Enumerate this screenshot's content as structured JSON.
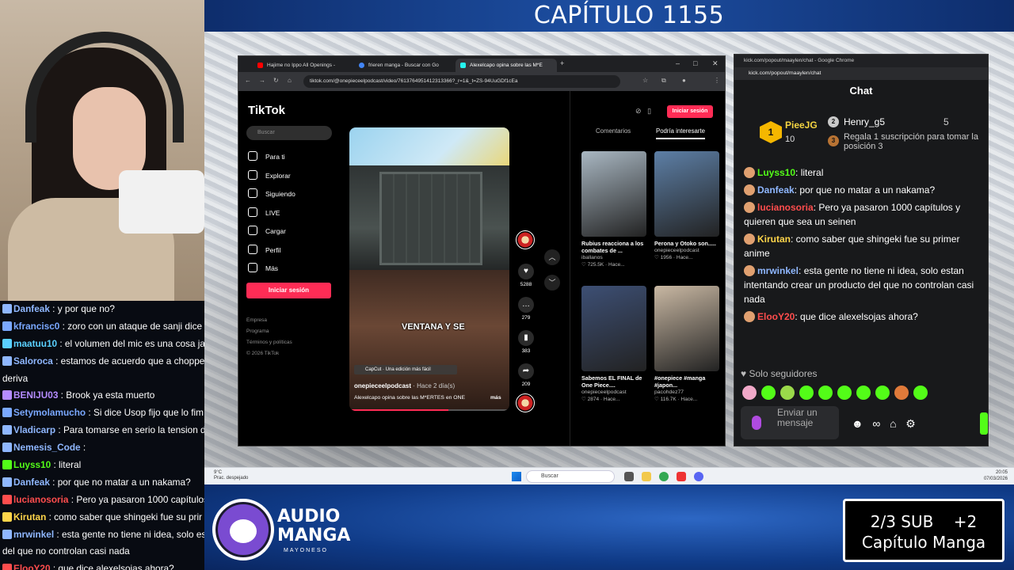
{
  "stream": {
    "chapter_title": "CAPÍTULO 1155",
    "logo_line1": "AUDIO",
    "logo_line2": "MANGA",
    "logo_line3": "MAYONESO",
    "subgoal_line1": "2/3 SUB    +2",
    "subgoal_line2": "Capítulo Manga"
  },
  "stream_chat": [
    {
      "name": "Danfeak",
      "text": " : y por que no?",
      "color": "#8fb7ff"
    },
    {
      "name": "kfrancisc0",
      "text": " : zoro con un ataque de sanji dice",
      "color": "#7aa8ff"
    },
    {
      "name": "maatuu10",
      "text": " : el volumen del mic es una cosa jaja",
      "color": "#5ad0ff"
    },
    {
      "name": "Saloroca",
      "text": " : estamos de acuerdo que a chopper s",
      "color": "#8fb7ff"
    },
    {
      "name": "",
      "text": "deriva",
      "color": "#ffffff"
    },
    {
      "name": "BENIJU03",
      "text": " : Brook ya esta muerto",
      "color": "#b58cff"
    },
    {
      "name": "Setymolamucho",
      "text": " : Si dice Usop fijo que lo fim",
      "color": "#7aa8ff"
    },
    {
      "name": "Vladicarp",
      "text": " : Para tomarse en serio la tension d",
      "color": "#8fb7ff"
    },
    {
      "name": "Nemesis_Code",
      "text": " :",
      "color": "#8fb7ff"
    },
    {
      "name": "Luyss10",
      "text": " : literal",
      "color": "#53fc18"
    },
    {
      "name": "Danfeak",
      "text": " : por que no matar a un nakama?",
      "color": "#8fb7ff"
    },
    {
      "name": "lucianosoria",
      "text": " : Pero ya pasaron 1000 capítulos y",
      "color": "#ff4d4d"
    },
    {
      "name": "Kirutan",
      "text": " : como saber que shingeki fue su prir",
      "color": "#ffd54a"
    },
    {
      "name": "mrwinkel",
      "text": " : esta gente no tiene ni idea, solo esta",
      "color": "#8fb7ff"
    },
    {
      "name": "",
      "text": "del que no controlan casi nada",
      "color": "#ffffff"
    },
    {
      "name": "ElooY20",
      "text": " : que dice alexelsojas ahora?",
      "color": "#ff4d4d"
    }
  ],
  "taskbar": {
    "weather_temp": "9°C",
    "weather_desc": "Prac. despejado",
    "search_placeholder": "Buscar",
    "time": "20:05",
    "date": "07/03/2026"
  },
  "browser": {
    "tabs": [
      {
        "label": "Hajime no Ippo All Openings -",
        "fav": "#ff0000"
      },
      {
        "label": "frieren manga - Buscar con Go",
        "fav": "#4285f4"
      },
      {
        "label": "Alexelcapo opina sobre las M*E",
        "fav": "#25f4ee"
      }
    ],
    "url": "tiktok.com/@onepieceelpodcast/video/7613764951412313366?_r=1&_t=ZS-94UuGDf1cEa"
  },
  "tiktok": {
    "logo": "TikTok",
    "search_placeholder": "Buscar",
    "nav": [
      "Para ti",
      "Explorar",
      "Siguiendo",
      "LIVE",
      "Cargar",
      "Perfil",
      "Más"
    ],
    "login_button": "Iniciar sesión",
    "footer": [
      "Empresa",
      "Programa",
      "Términos y políticas",
      "© 2026 TikTok"
    ],
    "video": {
      "caption": "VENTANA Y SE",
      "capcut": "CapCut · Una edición más fácil",
      "author": "onepieceelpodcast",
      "ago": " · Hace 2 día(s)",
      "description": "Alexelcapo opina sobre las M*ERTES en ONE",
      "more": "más",
      "progress": 0.62
    },
    "actions": {
      "likes": "5288",
      "comments": "279",
      "saves": "383",
      "shares": "209"
    },
    "right_tabs": [
      "Comentarios",
      "Podría interesarte"
    ],
    "cards": [
      {
        "title": "Rubius reacciona a los combates de ...",
        "user": "iballanos",
        "stats": "♡ 725.5K · Hace...",
        "color": "#a9b7c2"
      },
      {
        "title": "Perona y Otoko son.....",
        "user": "onepieceelpodcast",
        "stats": "♡ 1956 · Hace...",
        "color": "#5d7fa6"
      },
      {
        "title": "Sabemos EL FINAL de One Piece....",
        "user": "onepieceelpodcast",
        "stats": "♡ 2874 · Hace...",
        "color": "#3d4f74"
      },
      {
        "title": "#onepiece #manga #japon...",
        "user": "pacohdez77",
        "stats": "♡ 116.7K · Hace...",
        "color": "#c9b8a3"
      }
    ]
  },
  "kick": {
    "window_title": "kick.com/popout/maaylen/chat - Google Chrome",
    "url": "kick.com/popout/maaylen/chat",
    "header": "Chat",
    "leaderboard": {
      "first_rank": "1",
      "first_name": "PieeJG",
      "first_value": "10",
      "second_rank": "2",
      "second_name": "Henry_g5",
      "second_value": "5",
      "third_rank": "3",
      "third_text": "Regala 1 suscripción para tomar la posición 3"
    },
    "messages": [
      {
        "name": "Luyss10",
        "text": ": literal",
        "color": "#53fc18"
      },
      {
        "name": "Danfeak",
        "text": ": por que no matar a un nakama?",
        "color": "#8fb7ff"
      },
      {
        "name": "lucianosoria",
        "text": ": Pero ya pasaron 1000 capítulos y quieren que sea un seinen",
        "color": "#ff4d4d"
      },
      {
        "name": "Kirutan",
        "text": ": como saber que shingeki fue su primer anime",
        "color": "#ffd54a"
      },
      {
        "name": "mrwinkel",
        "text": ": esta gente no tiene ni idea, solo estan intentando crear un producto del que no controlan casi nada",
        "color": "#8fb7ff"
      },
      {
        "name": "ElooY20",
        "text": ": que dice alexelsojas ahora?",
        "color": "#ff4d4d"
      }
    ],
    "followers_only": "Solo seguidores",
    "input_placeholder": "Enviar un mensaje"
  }
}
